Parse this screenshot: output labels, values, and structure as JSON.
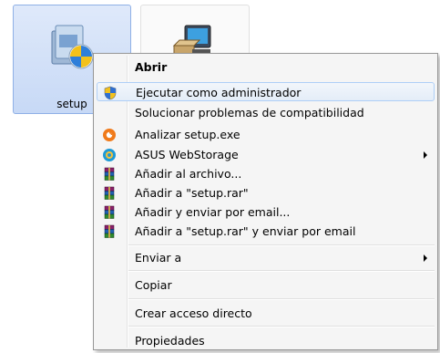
{
  "desktop": {
    "files": [
      {
        "label": "setup",
        "icon": "setup-installer-icon"
      },
      {
        "label": "",
        "icon": "install-computer-icon"
      }
    ]
  },
  "context_menu": {
    "items": [
      {
        "label": "Abrir",
        "bold": true,
        "icon": ""
      },
      {
        "label": "Ejecutar como administrador",
        "icon": "uac-shield-icon"
      },
      {
        "label": "Solucionar problemas de compatibilidad",
        "icon": ""
      },
      {
        "label": "Analizar setup.exe",
        "icon": "avast-icon"
      },
      {
        "label": "ASUS WebStorage",
        "icon": "asus-webstorage-icon",
        "submenu": true
      },
      {
        "label": "Añadir al archivo...",
        "icon": "winrar-icon"
      },
      {
        "label": "Añadir a \"setup.rar\"",
        "icon": "winrar-icon"
      },
      {
        "label": "Añadir y enviar por email...",
        "icon": "winrar-icon"
      },
      {
        "label": "Añadir a \"setup.rar\" y enviar por email",
        "icon": "winrar-icon"
      },
      {
        "label": "Enviar a",
        "icon": "",
        "submenu": true
      },
      {
        "label": "Copiar",
        "icon": ""
      },
      {
        "label": "Crear acceso directo",
        "icon": ""
      },
      {
        "label": "Propiedades",
        "icon": ""
      }
    ]
  }
}
